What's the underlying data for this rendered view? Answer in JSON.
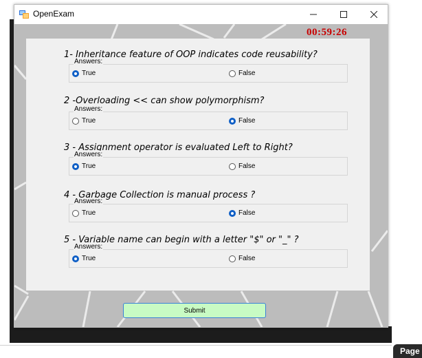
{
  "window": {
    "title": "OpenExam",
    "controls": {
      "minimize": "—",
      "maximize": "☐",
      "close": "✕"
    }
  },
  "timer": "00:59:26",
  "questions": [
    {
      "title": "1- Inheritance feature of OOP indicates code reusability?",
      "group_label": "Answers:",
      "options": [
        {
          "label": "True",
          "checked": true
        },
        {
          "label": "False",
          "checked": false
        }
      ]
    },
    {
      "title": "2 -Overloading << can show polymorphism?",
      "group_label": "Answers:",
      "options": [
        {
          "label": "True",
          "checked": false
        },
        {
          "label": "False",
          "checked": true
        }
      ]
    },
    {
      "title": "3 - Assignment operator is evaluated Left to Right?",
      "group_label": "Answers:",
      "options": [
        {
          "label": "True",
          "checked": true
        },
        {
          "label": "False",
          "checked": false
        }
      ]
    },
    {
      "title": "4 - Garbage Collection is manual process ?",
      "group_label": "Answers:",
      "options": [
        {
          "label": "True",
          "checked": false
        },
        {
          "label": "False",
          "checked": true
        }
      ]
    },
    {
      "title": "5 - Variable name can begin with a letter \"$\" or \"_\" ?",
      "group_label": "Answers:",
      "options": [
        {
          "label": "True",
          "checked": true
        },
        {
          "label": "False",
          "checked": false
        }
      ]
    }
  ],
  "submit_label": "Submit",
  "page_tab": "Page",
  "colors": {
    "timer": "#c80000",
    "radio_checked": "#0f5fc6",
    "submit_bg": "#c8fbc4"
  }
}
